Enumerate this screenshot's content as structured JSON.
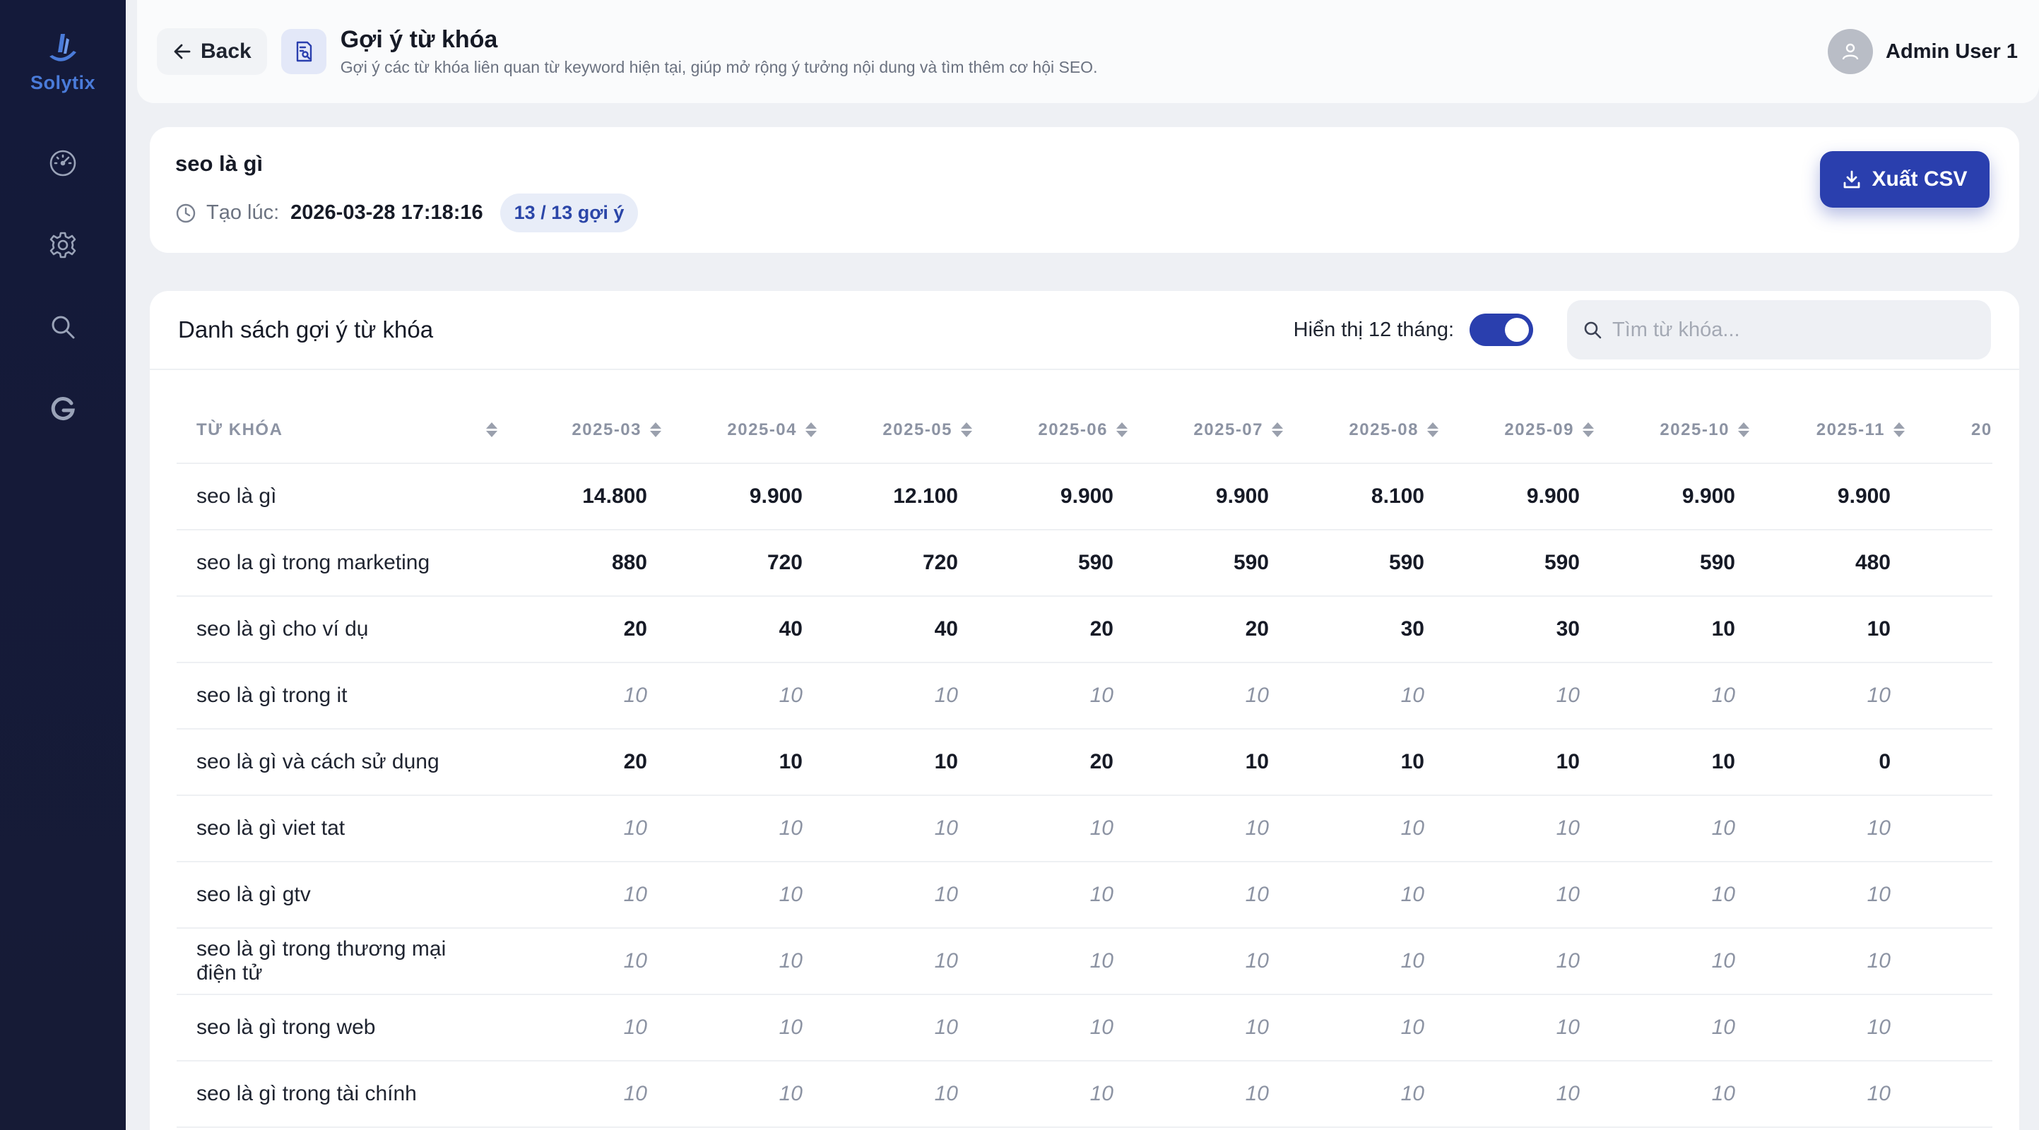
{
  "brand": {
    "name": "Solytix",
    "accent": "#2a3fae",
    "sidebar_bg": "#141a3a"
  },
  "sidebar": {
    "items": [
      {
        "name": "dashboard",
        "icon": "speedometer-icon"
      },
      {
        "name": "settings",
        "icon": "gear-icon"
      },
      {
        "name": "search",
        "icon": "search-icon"
      },
      {
        "name": "google",
        "icon": "google-g-icon"
      }
    ]
  },
  "header": {
    "back_label": "Back",
    "title": "Gợi ý từ khóa",
    "subtitle": "Gợi ý các từ khóa liên quan từ keyword hiện tại, giúp mở rộng ý tưởng nội dung và tìm thêm cơ hội SEO.",
    "user_name": "Admin User 1"
  },
  "info": {
    "keyword": "seo là gì",
    "created_label": "Tạo lúc:",
    "created_value": "2026-03-28 17:18:16",
    "count_badge": "13 / 13 gợi ý",
    "export_label": "Xuất CSV"
  },
  "table": {
    "title": "Danh sách gợi ý từ khóa",
    "toggle_label": "Hiển thị 12 tháng:",
    "toggle_on": true,
    "search_placeholder": "Tìm từ khóa...",
    "search_value": "",
    "keyword_header": "TỪ KHÓA",
    "months": [
      "2025-03",
      "2025-04",
      "2025-05",
      "2025-06",
      "2025-07",
      "2025-08",
      "2025-09",
      "2025-10",
      "2025-11",
      "20"
    ],
    "rows": [
      {
        "keyword": "seo là gì",
        "dim": false,
        "values": [
          "14.800",
          "9.900",
          "12.100",
          "9.900",
          "9.900",
          "8.100",
          "9.900",
          "9.900",
          "9.900"
        ]
      },
      {
        "keyword": "seo la gì trong marketing",
        "dim": false,
        "values": [
          "880",
          "720",
          "720",
          "590",
          "590",
          "590",
          "590",
          "590",
          "480"
        ]
      },
      {
        "keyword": "seo là gì cho ví dụ",
        "dim": false,
        "values": [
          "20",
          "40",
          "40",
          "20",
          "20",
          "30",
          "30",
          "10",
          "10"
        ]
      },
      {
        "keyword": "seo là gì trong it",
        "dim": true,
        "values": [
          "10",
          "10",
          "10",
          "10",
          "10",
          "10",
          "10",
          "10",
          "10"
        ]
      },
      {
        "keyword": "seo là gì và cách sử dụng",
        "dim": false,
        "values": [
          "20",
          "10",
          "10",
          "20",
          "10",
          "10",
          "10",
          "10",
          "0"
        ]
      },
      {
        "keyword": "seo là gì viet tat",
        "dim": true,
        "values": [
          "10",
          "10",
          "10",
          "10",
          "10",
          "10",
          "10",
          "10",
          "10"
        ]
      },
      {
        "keyword": "seo là gì gtv",
        "dim": true,
        "values": [
          "10",
          "10",
          "10",
          "10",
          "10",
          "10",
          "10",
          "10",
          "10"
        ]
      },
      {
        "keyword": "seo là gì trong thương mại điện tử",
        "dim": true,
        "values": [
          "10",
          "10",
          "10",
          "10",
          "10",
          "10",
          "10",
          "10",
          "10"
        ]
      },
      {
        "keyword": "seo là gì trong web",
        "dim": true,
        "values": [
          "10",
          "10",
          "10",
          "10",
          "10",
          "10",
          "10",
          "10",
          "10"
        ]
      },
      {
        "keyword": "seo là gì trong tài chính",
        "dim": true,
        "values": [
          "10",
          "10",
          "10",
          "10",
          "10",
          "10",
          "10",
          "10",
          "10"
        ]
      }
    ]
  }
}
